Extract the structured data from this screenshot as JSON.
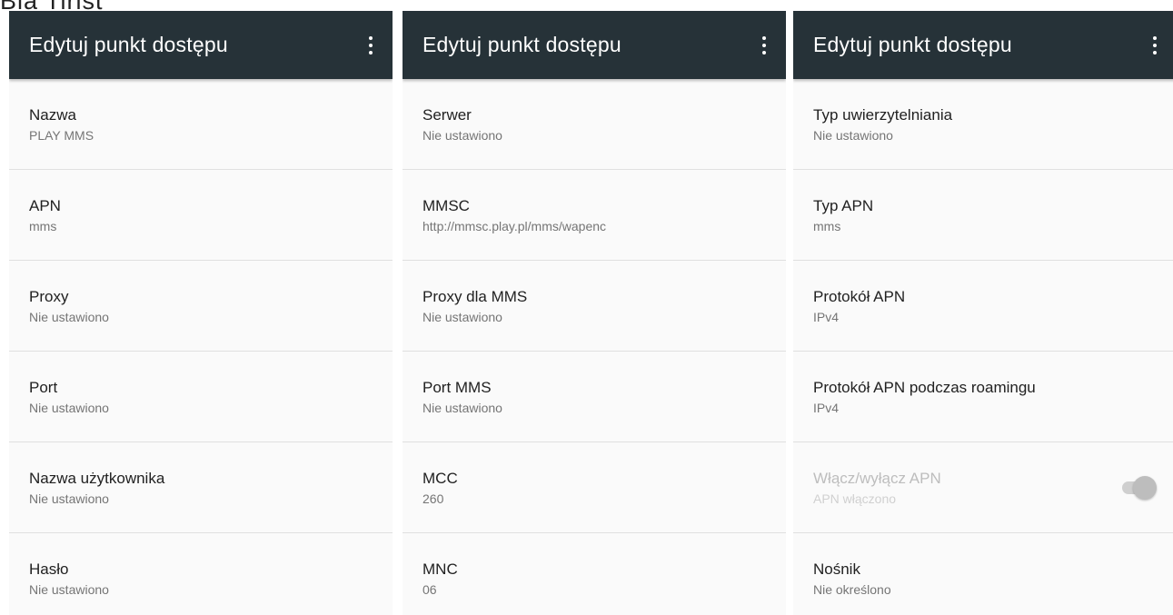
{
  "caption": "Bla Tirist",
  "panels": [
    {
      "title": "Edytuj punkt dostępu",
      "items": [
        {
          "title": "Nazwa",
          "summary": "PLAY MMS"
        },
        {
          "title": "APN",
          "summary": "mms"
        },
        {
          "title": "Proxy",
          "summary": "Nie ustawiono"
        },
        {
          "title": "Port",
          "summary": "Nie ustawiono"
        },
        {
          "title": "Nazwa użytkownika",
          "summary": "Nie ustawiono"
        },
        {
          "title": "Hasło",
          "summary": "Nie ustawiono"
        }
      ]
    },
    {
      "title": "Edytuj punkt dostępu",
      "items": [
        {
          "title": "Serwer",
          "summary": "Nie ustawiono"
        },
        {
          "title": "MMSC",
          "summary": "http://mmsc.play.pl/mms/wapenc"
        },
        {
          "title": "Proxy dla MMS",
          "summary": "Nie ustawiono"
        },
        {
          "title": "Port MMS",
          "summary": "Nie ustawiono"
        },
        {
          "title": "MCC",
          "summary": "260"
        },
        {
          "title": "MNC",
          "summary": "06"
        }
      ]
    },
    {
      "title": "Edytuj punkt dostępu",
      "items": [
        {
          "title": "Typ uwierzytelniania",
          "summary": "Nie ustawiono"
        },
        {
          "title": "Typ APN",
          "summary": "mms"
        },
        {
          "title": "Protokół APN",
          "summary": "IPv4"
        },
        {
          "title": "Protokół APN podczas roamingu",
          "summary": "IPv4"
        },
        {
          "title": "Włącz/wyłącz APN",
          "summary": "APN włączono",
          "toggle_on": true,
          "disabled": true
        },
        {
          "title": "Nośnik",
          "summary": "Nie określono"
        }
      ]
    }
  ],
  "colors": {
    "toolbar": "#263238",
    "background": "#fafafa",
    "divider": "#e0e0e0"
  },
  "icons": {
    "overflow_menu": "more-vert-icon"
  }
}
